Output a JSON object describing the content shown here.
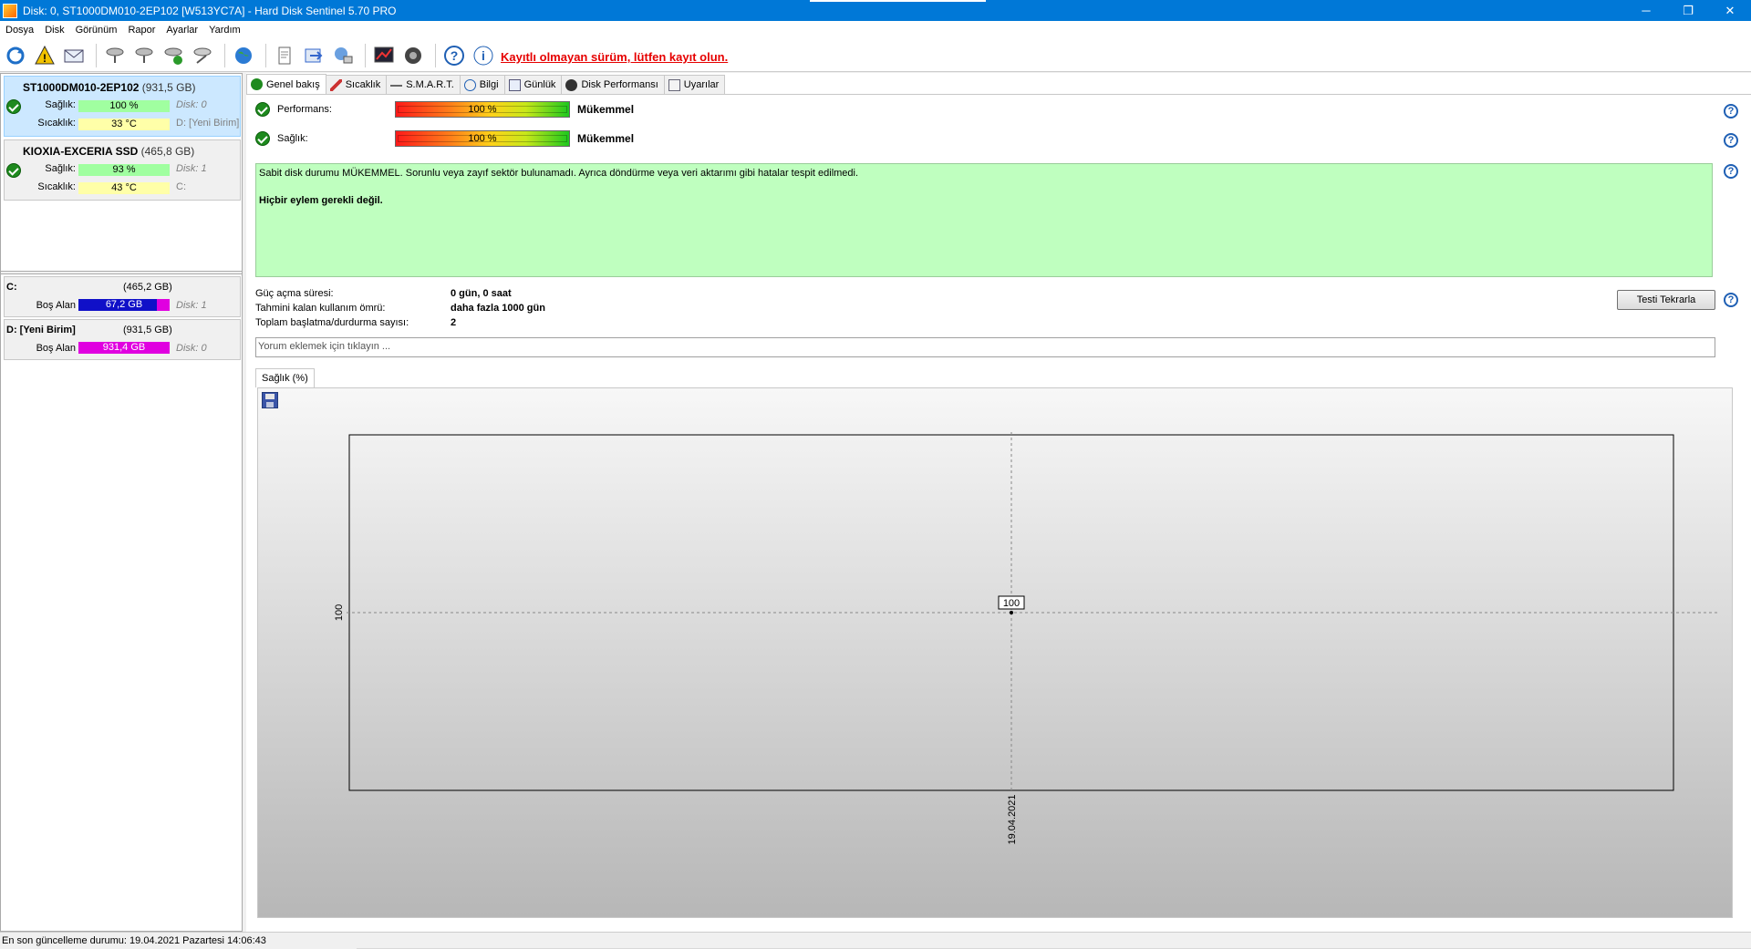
{
  "window": {
    "title": "Disk: 0, ST1000DM010-2EP102 [W513YC7A]  -  Hard Disk Sentinel 5.70 PRO",
    "controls": {
      "minimize": "─",
      "maximize": "❐",
      "close": "✕"
    }
  },
  "menu": [
    "Dosya",
    "Disk",
    "Görünüm",
    "Rapor",
    "Ayarlar",
    "Yardım"
  ],
  "toolbar": {
    "icons": [
      "refresh-icon",
      "warning-icon",
      "mail-icon",
      "disk-check-icon",
      "disk-test-icon",
      "disk-ok-icon",
      "disk-tool-icon",
      "globe-icon",
      "report-icon",
      "send-icon",
      "network-icon",
      "chart-icon",
      "sound-icon",
      "help-icon",
      "info-icon"
    ],
    "registration_warning": "Kayıtlı olmayan sürüm, lütfen kayıt olun."
  },
  "disks": [
    {
      "name": "ST1000DM010-2EP102",
      "size": "(931,5 GB)",
      "health_label": "Sağlık:",
      "health": "100 %",
      "health_value": 100,
      "temp_label": "Sıcaklık:",
      "temp": "33 °C",
      "disk_id": "Disk: 0",
      "volume": "D: [Yeni Birim]"
    },
    {
      "name": "KIOXIA-EXCERIA SSD",
      "size": "(465,8 GB)",
      "health_label": "Sağlık:",
      "health": "93 %",
      "health_value": 93,
      "temp_label": "Sıcaklık:",
      "temp": "43 °C",
      "disk_id": "Disk: 1",
      "volume": "C:"
    }
  ],
  "volumes": [
    {
      "name": "C:",
      "size": "(465,2 GB)",
      "free_label": "Boş Alan",
      "free": "67,2 GB",
      "free_fraction": 0.856,
      "disk_id": "Disk: 1",
      "free_color": "#1010c8"
    },
    {
      "name": "D: [Yeni Birim]",
      "size": "(931,5 GB)",
      "free_label": "Boş Alan",
      "free": "931,4 GB",
      "free_fraction": 0.0,
      "disk_id": "Disk: 0",
      "free_color": "#e000e0"
    }
  ],
  "tabs": [
    "Genel bakış",
    "Sıcaklık",
    "S.M.A.R.T.",
    "Bilgi",
    "Günlük",
    "Disk Performansı",
    "Uyarılar"
  ],
  "overview": {
    "performance_label": "Performans:",
    "performance": "100 %",
    "performance_verdict": "Mükemmel",
    "health_label": "Sağlık:",
    "health": "100 %",
    "health_verdict": "Mükemmel",
    "message_line1": "Sabit disk durumu MÜKEMMEL. Sorunlu veya zayıf sektör bulunamadı. Ayrıca döndürme veya veri aktarımı gibi hatalar tespit edilmedi.",
    "message_line2": "Hiçbir eylem gerekli değil.",
    "info": [
      {
        "key": "Güç açma süresi:",
        "value": "0 gün, 0 saat"
      },
      {
        "key": "Tahmini kalan kullanım ömrü:",
        "value": "daha fazla 1000 gün"
      },
      {
        "key": "Toplam başlatma/durdurma sayısı:",
        "value": "2"
      }
    ],
    "repeat_button": "Testi Tekrarla",
    "comment_placeholder": "Yorum eklemek için tıklayın ...",
    "help_glyph": "?"
  },
  "chart_tab": "Sağlık (%)",
  "chart_data": {
    "type": "line",
    "x": [
      "19.04.2021"
    ],
    "series": [
      {
        "values": [
          100
        ]
      }
    ],
    "ytick": "100",
    "point_label": "100",
    "grid": true
  },
  "statusbar": {
    "text": "En son güncelleme durumu: 19.04.2021 Pazartesi 14:06:43"
  }
}
